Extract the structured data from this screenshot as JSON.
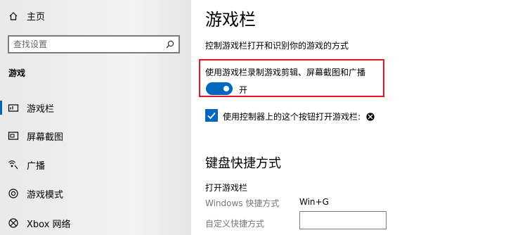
{
  "sidebar": {
    "home_label": "主页",
    "search_placeholder": "查找设置",
    "section": "游戏",
    "items": [
      {
        "label": "游戏栏",
        "icon": "game-bar-icon",
        "active": true
      },
      {
        "label": "屏幕截图",
        "icon": "capture-icon",
        "active": false
      },
      {
        "label": "广播",
        "icon": "broadcast-icon",
        "active": false
      },
      {
        "label": "游戏模式",
        "icon": "game-mode-icon",
        "active": false
      },
      {
        "label": "Xbox 网络",
        "icon": "xbox-icon",
        "active": false
      }
    ]
  },
  "main": {
    "title": "游戏栏",
    "description": "控制游戏栏打开和识别你的游戏的方式",
    "record_toggle": {
      "label": "使用游戏栏录制游戏剪辑、屏幕截图和广播",
      "state": "开",
      "on": true
    },
    "controller_checkbox": {
      "label": "使用控制器上的这个按钮打开游戏栏:",
      "checked": true,
      "icon": "xbox-icon"
    },
    "keyboard_section": {
      "title": "键盘快捷方式",
      "open_game_bar": "打开游戏栏",
      "windows_shortcut_label": "Windows 快捷方式",
      "windows_shortcut_value": "Win+G",
      "custom_shortcut_label": "自定义快捷方式",
      "custom_shortcut_value": ""
    }
  },
  "colors": {
    "accent": "#0067c0",
    "highlight_border": "#e81123"
  }
}
